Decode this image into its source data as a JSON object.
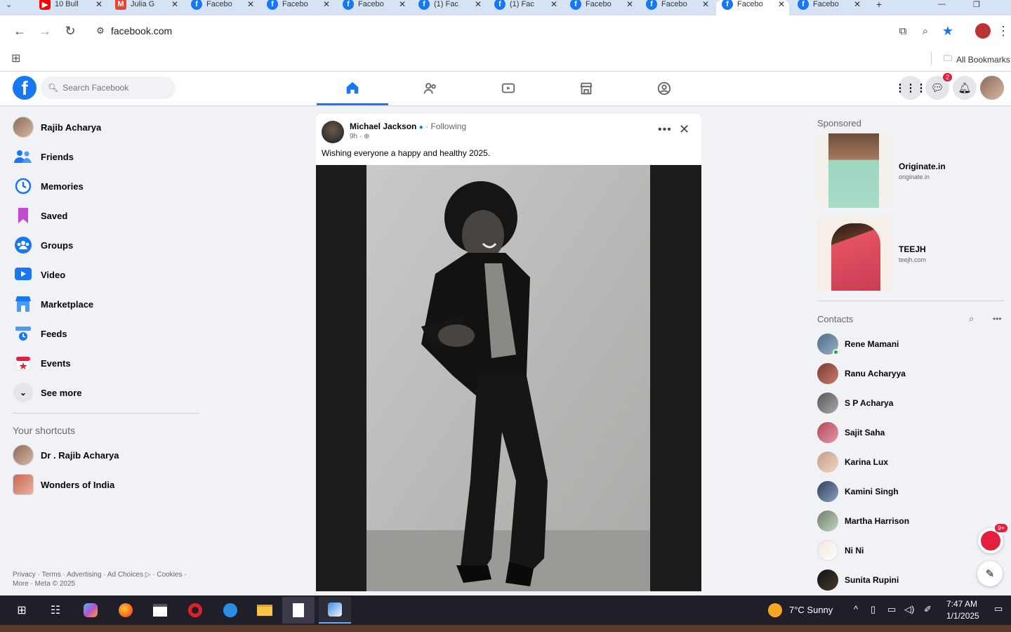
{
  "browser": {
    "tabs": [
      {
        "label": "10 Bull"
      },
      {
        "label": "Julia G"
      },
      {
        "label": "Facebo"
      },
      {
        "label": "Facebo"
      },
      {
        "label": "Facebo"
      },
      {
        "label": "(1) Fac"
      },
      {
        "label": "(1) Fac"
      },
      {
        "label": "Facebo"
      },
      {
        "label": "Facebo"
      },
      {
        "label": "Facebo"
      },
      {
        "label": "Facebo"
      }
    ],
    "url": "facebook.com",
    "bookmarks_label": "All Bookmarks"
  },
  "facebook": {
    "search_placeholder": "Search Facebook",
    "messenger_badge": "2"
  },
  "left_nav": {
    "items": [
      {
        "label": "Rajib Acharya"
      },
      {
        "label": "Friends"
      },
      {
        "label": "Memories"
      },
      {
        "label": "Saved"
      },
      {
        "label": "Groups"
      },
      {
        "label": "Video"
      },
      {
        "label": "Marketplace"
      },
      {
        "label": "Feeds"
      },
      {
        "label": "Events"
      },
      {
        "label": "See more"
      }
    ],
    "shortcuts_heading": "Your shortcuts",
    "shortcuts": [
      {
        "label": "Dr . Rajib Acharya"
      },
      {
        "label": "Wonders of India"
      }
    ],
    "footer_line1": "Privacy · Terms · Advertising · Ad Choices ▷ · Cookies ·",
    "footer_line2": "More · Meta © 2025"
  },
  "post": {
    "author": "Michael Jackson",
    "follow_status": "· Following",
    "time": "9h ·",
    "text": "Wishing everyone a happy and healthy 2025."
  },
  "right_col": {
    "sponsored_heading": "Sponsored",
    "ads": [
      {
        "name": "Originate.in",
        "url": "originate.in"
      },
      {
        "name": "TEEJH",
        "url": "teejh.com"
      }
    ],
    "contacts_heading": "Contacts",
    "contacts": [
      {
        "name": "Rene Mamani"
      },
      {
        "name": "Ranu Acharyya"
      },
      {
        "name": "S P Acharya"
      },
      {
        "name": "Sajit Saha"
      },
      {
        "name": "Karina Lux"
      },
      {
        "name": "Kamini Singh"
      },
      {
        "name": "Martha Harrison"
      },
      {
        "name": "Ni Ni"
      },
      {
        "name": "Sunita Rupini"
      }
    ],
    "chat_badge": "9+"
  },
  "taskbar": {
    "weather": "7°C Sunny",
    "time": "7:47 AM",
    "date": "1/1/2025"
  },
  "colors": {
    "accent": "#1877f2",
    "background": "#f0f2f5",
    "taskbar": "#1f1f2a"
  }
}
